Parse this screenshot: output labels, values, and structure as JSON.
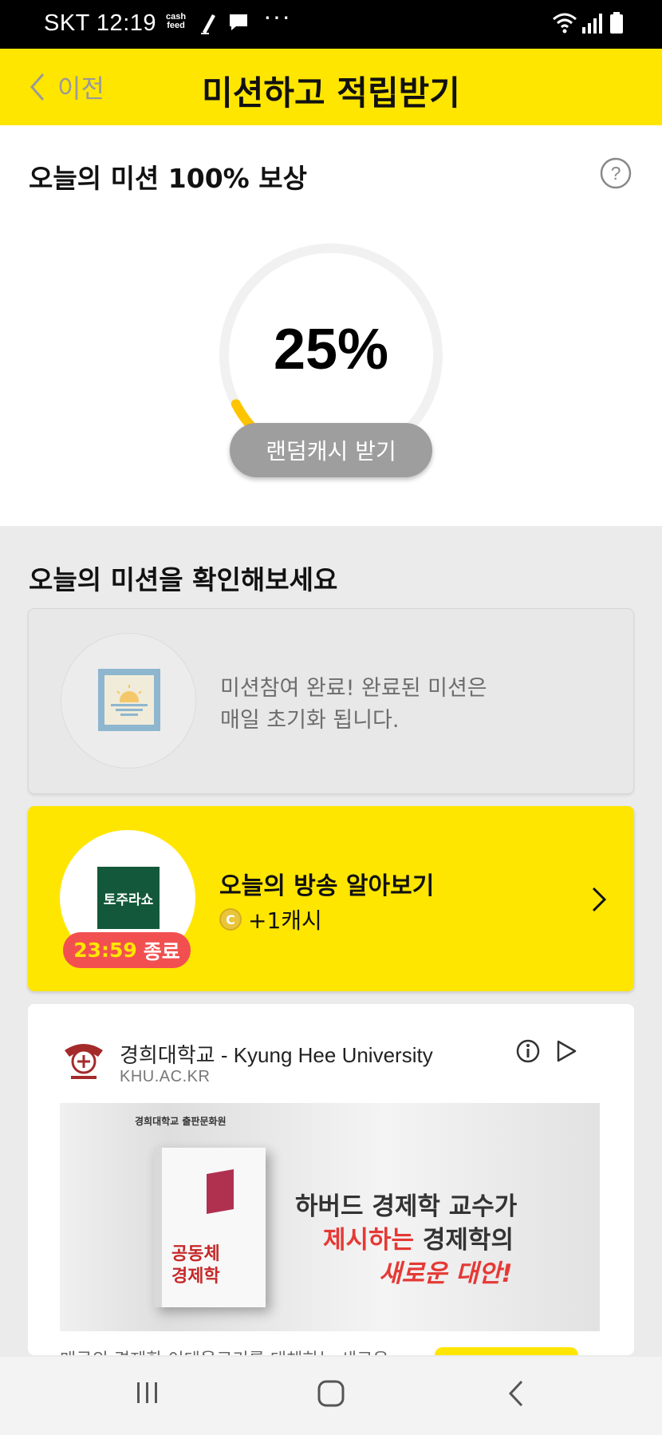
{
  "status_bar": {
    "time": "SKT 12:19",
    "app_badge_line1": "cash",
    "app_badge_line2": "feed",
    "more": "···"
  },
  "header": {
    "back_label": "이전",
    "title": "미션하고 적립받기"
  },
  "reward": {
    "title": "오늘의 미션 100% 보상",
    "progress_text": "25%",
    "progress": 0.25,
    "random_button": "랜덤캐시 받기",
    "accent_color": "#ffc400"
  },
  "missions": {
    "section_title": "오늘의 미션을 확인해보세요",
    "completed": {
      "message_line1": "미션참여 완료!  완료된 미션은",
      "message_line2": "매일 초기화 됩니다."
    },
    "broadcast": {
      "logo_text": "토주라쇼",
      "timer": "23:59",
      "timer_suffix": "종료",
      "title": "오늘의 방송 알아보기",
      "coin_symbol": "C",
      "reward": "+1캐시"
    }
  },
  "ad": {
    "advertiser": "경희대학교 - Kyung Hee University",
    "url": "KHU.AC.KR",
    "banner_brand": "경희대학교 출판문화원",
    "book_title_line1": "공동체",
    "book_title_line2": "경제학",
    "headline_line1": "하버드 경제학 교수가",
    "headline_line2_red": "제시하는",
    "headline_line2_rest": " 경제학의",
    "headline_line3": "새로운 대안!",
    "subtext": "매큰의 경제학 이데올로기를 대체하는 새로운"
  },
  "colors": {
    "brand_yellow": "#ffe600",
    "timer_red": "#f25050"
  }
}
